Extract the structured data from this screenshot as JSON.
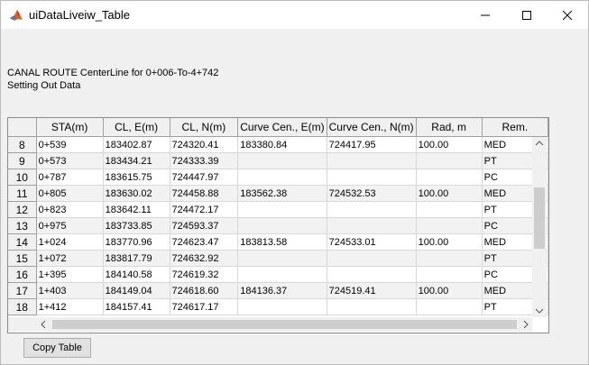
{
  "window": {
    "title": "uiDataLiveiw_Table"
  },
  "header": {
    "line1": "CANAL ROUTE CenterLine for 0+006-To-4+742",
    "line2": "Setting Out Data"
  },
  "table": {
    "columns": [
      "STA(m)",
      "CL, E(m)",
      "CL, N(m)",
      "Curve Cen., E(m)",
      "Curve Cen., N(m)",
      "Rad, m",
      "Rem."
    ],
    "rows": [
      {
        "n": "8",
        "cells": [
          "0+539",
          "183402.87",
          "724320.41",
          "183380.84",
          "724417.95",
          "100.00",
          "MED"
        ]
      },
      {
        "n": "9",
        "cells": [
          "0+573",
          "183434.21",
          "724333.39",
          "",
          "",
          "",
          "PT"
        ]
      },
      {
        "n": "10",
        "cells": [
          "0+787",
          "183615.75",
          "724447.97",
          "",
          "",
          "",
          "PC"
        ]
      },
      {
        "n": "11",
        "cells": [
          "0+805",
          "183630.02",
          "724458.88",
          "183562.38",
          "724532.53",
          "100.00",
          "MED"
        ]
      },
      {
        "n": "12",
        "cells": [
          "0+823",
          "183642.11",
          "724472.17",
          "",
          "",
          "",
          "PT"
        ]
      },
      {
        "n": "13",
        "cells": [
          "0+975",
          "183733.85",
          "724593.37",
          "",
          "",
          "",
          "PC"
        ]
      },
      {
        "n": "14",
        "cells": [
          "1+024",
          "183770.96",
          "724623.47",
          "183813.58",
          "724533.01",
          "100.00",
          "MED"
        ]
      },
      {
        "n": "15",
        "cells": [
          "1+072",
          "183817.79",
          "724632.92",
          "",
          "",
          "",
          "PT"
        ]
      },
      {
        "n": "16",
        "cells": [
          "1+395",
          "184140.58",
          "724619.32",
          "",
          "",
          "",
          "PC"
        ]
      },
      {
        "n": "17",
        "cells": [
          "1+403",
          "184149.04",
          "724618.60",
          "184136.37",
          "724519.41",
          "100.00",
          "MED"
        ]
      },
      {
        "n": "18",
        "cells": [
          "1+412",
          "184157.41",
          "724617.17",
          "",
          "",
          "",
          "PT"
        ]
      }
    ]
  },
  "buttons": {
    "copy_table": "Copy Table"
  },
  "icons": {
    "app": "matlab-logo-icon",
    "minimize": "minimize-icon",
    "maximize": "maximize-icon",
    "close": "close-icon"
  },
  "colors": {
    "title_bar": "#ffffff",
    "window_bg": "#f0f0f0",
    "alt_row": "#f2f2f2"
  }
}
